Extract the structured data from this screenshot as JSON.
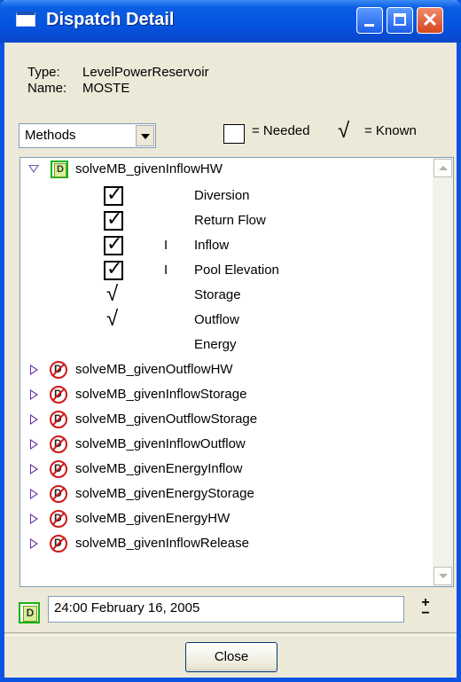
{
  "window": {
    "title": "Dispatch Detail"
  },
  "info": {
    "type_label": "Type:",
    "type_value": "LevelPowerReservoir",
    "name_label": "Name:",
    "name_value": "MOSTE"
  },
  "mode_select": {
    "value": "Methods"
  },
  "legend": {
    "needed_text": "= Needed",
    "check_glyph": "√",
    "known_text": "= Known"
  },
  "methods": [
    {
      "name": "solveMB_givenInflowHW",
      "expanded": true,
      "status": "ok"
    },
    {
      "name": "solveMB_givenOutflowHW",
      "expanded": false,
      "status": "blocked"
    },
    {
      "name": "solveMB_givenInflowStorage",
      "expanded": false,
      "status": "blocked"
    },
    {
      "name": "solveMB_givenOutflowStorage",
      "expanded": false,
      "status": "blocked"
    },
    {
      "name": "solveMB_givenInflowOutflow",
      "expanded": false,
      "status": "blocked"
    },
    {
      "name": "solveMB_givenEnergyInflow",
      "expanded": false,
      "status": "blocked"
    },
    {
      "name": "solveMB_givenEnergyStorage",
      "expanded": false,
      "status": "blocked"
    },
    {
      "name": "solveMB_givenEnergyHW",
      "expanded": false,
      "status": "blocked"
    },
    {
      "name": "solveMB_givenInflowRelease",
      "expanded": false,
      "status": "blocked"
    }
  ],
  "variables": [
    {
      "name": "Diversion",
      "mark": "checkbox",
      "bar": ""
    },
    {
      "name": "Return Flow",
      "mark": "checkbox",
      "bar": ""
    },
    {
      "name": "Inflow",
      "mark": "checkbox",
      "bar": "I"
    },
    {
      "name": "Pool Elevation",
      "mark": "checkbox",
      "bar": "I"
    },
    {
      "name": "Storage",
      "mark": "check",
      "bar": ""
    },
    {
      "name": "Outflow",
      "mark": "check",
      "bar": ""
    },
    {
      "name": "Energy",
      "mark": "none",
      "bar": ""
    }
  ],
  "timestep": {
    "value": "24:00 February 16, 2005",
    "spinner_plus": "+",
    "spinner_minus": "−"
  },
  "buttons": {
    "close": "Close"
  },
  "icons": {
    "dispatch_ok": "D",
    "dispatch_blocked": "D"
  },
  "colors": {
    "title_bar": "#0553e0",
    "ok_border": "#15b315",
    "blocked": "#d01818"
  }
}
